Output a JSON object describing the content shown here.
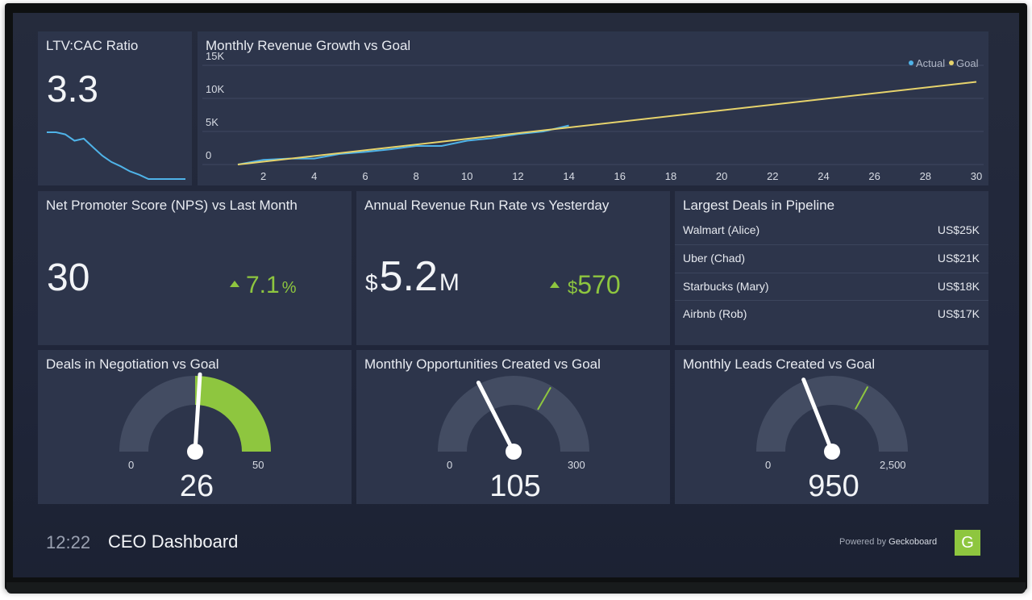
{
  "ltv": {
    "title": "LTV:CAC Ratio",
    "value": "3.3",
    "sparkline": [
      2.9,
      2.9,
      2.85,
      2.7,
      2.75,
      2.55,
      2.35,
      2.2,
      2.1,
      1.98,
      1.9,
      1.8,
      1.8,
      1.8,
      1.8,
      1.8
    ]
  },
  "revenue": {
    "title": "Monthly Revenue Growth vs Goal",
    "legend": {
      "actual": "Actual",
      "goal": "Goal"
    },
    "colors": {
      "actual": "#4fb3e8",
      "goal": "#e6d36c"
    },
    "y_ticks": [
      "15K",
      "10K",
      "5K",
      "0"
    ],
    "x_ticks": [
      "2",
      "4",
      "6",
      "8",
      "10",
      "12",
      "14",
      "16",
      "18",
      "20",
      "22",
      "24",
      "26",
      "28",
      "30"
    ]
  },
  "nps": {
    "title": "Net Promoter Score (NPS) vs Last Month",
    "value": "30",
    "change": "7.1",
    "change_unit": "%"
  },
  "arr": {
    "title": "Annual Revenue Run Rate vs Yesterday",
    "currency": "$",
    "value": "5.2",
    "suffix": "M",
    "change_currency": "$",
    "change": "570"
  },
  "deals": {
    "title": "Largest Deals in Pipeline",
    "rows": [
      {
        "name": "Walmart (Alice)",
        "value": "US$25K"
      },
      {
        "name": "Uber (Chad)",
        "value": "US$21K"
      },
      {
        "name": "Starbucks (Mary)",
        "value": "US$18K"
      },
      {
        "name": "Airbnb (Rob)",
        "value": "US$17K"
      }
    ]
  },
  "gauges": [
    {
      "title": "Deals in Negotiation vs Goal",
      "min": "0",
      "max": "50",
      "value": "26",
      "val": 26,
      "vmax": 50,
      "goal": 25,
      "filled": true
    },
    {
      "title": "Monthly Opportunities Created vs Goal",
      "min": "0",
      "max": "300",
      "value": "105",
      "val": 105,
      "vmax": 300,
      "goal": 200,
      "filled": false
    },
    {
      "title": "Monthly Leads Created vs Goal",
      "min": "0",
      "max": "2,500",
      "value": "950",
      "val": 950,
      "vmax": 2500,
      "goal": 1650,
      "filled": false
    }
  ],
  "footer": {
    "time": "12:22",
    "title": "CEO Dashboard",
    "powered_prefix": "Powered by",
    "powered_brand": "Geckoboard",
    "logo_letter": "G"
  },
  "chart_data": {
    "type": "line",
    "title": "Monthly Revenue Growth vs Goal",
    "xlabel": "",
    "ylabel": "",
    "xlim": [
      0,
      30
    ],
    "ylim": [
      0,
      15000
    ],
    "legend": "top-right",
    "grid": true,
    "series": [
      {
        "name": "Actual",
        "x": [
          1,
          2,
          3,
          4,
          5,
          6,
          7,
          8,
          9,
          10,
          11,
          12,
          13,
          14
        ],
        "values": [
          0,
          700,
          900,
          900,
          1600,
          1900,
          2300,
          2800,
          2800,
          3600,
          4000,
          4600,
          5000,
          5900
        ]
      },
      {
        "name": "Goal",
        "x": [
          1,
          30
        ],
        "values": [
          0,
          12500
        ]
      }
    ]
  }
}
